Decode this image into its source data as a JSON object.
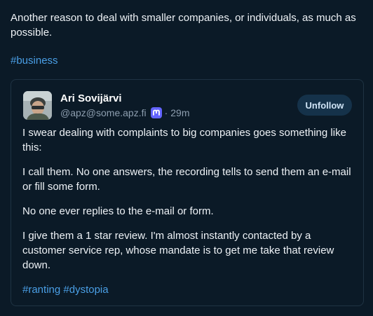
{
  "post": {
    "text": "Another reason to deal with smaller companies, or individuals, as much as possible.",
    "hashtag": "#business"
  },
  "quoted_post": {
    "author": {
      "name": "Ari Sovijärvi",
      "handle": "@apz@some.apz.fi",
      "separator": "·",
      "time": "29m"
    },
    "unfollow_label": "Unfollow",
    "paragraphs": [
      "I swear dealing with complaints to big companies goes something like this:",
      "I call them. No one answers, the recording tells to send them an e-mail or fill some form.",
      "No one ever replies to the e-mail or form.",
      "I give them a 1 star review. I'm almost instantly contacted by a customer service rep, whose mandate is to get me take that review down."
    ],
    "hashtags": [
      "#ranting",
      "#dystopia"
    ]
  },
  "colors": {
    "background": "#0b1a27",
    "link": "#4a9fe6",
    "button_bg": "#15324a",
    "mastodon_purple": "#6364ff"
  },
  "icons": {
    "server": "mastodon-icon"
  }
}
